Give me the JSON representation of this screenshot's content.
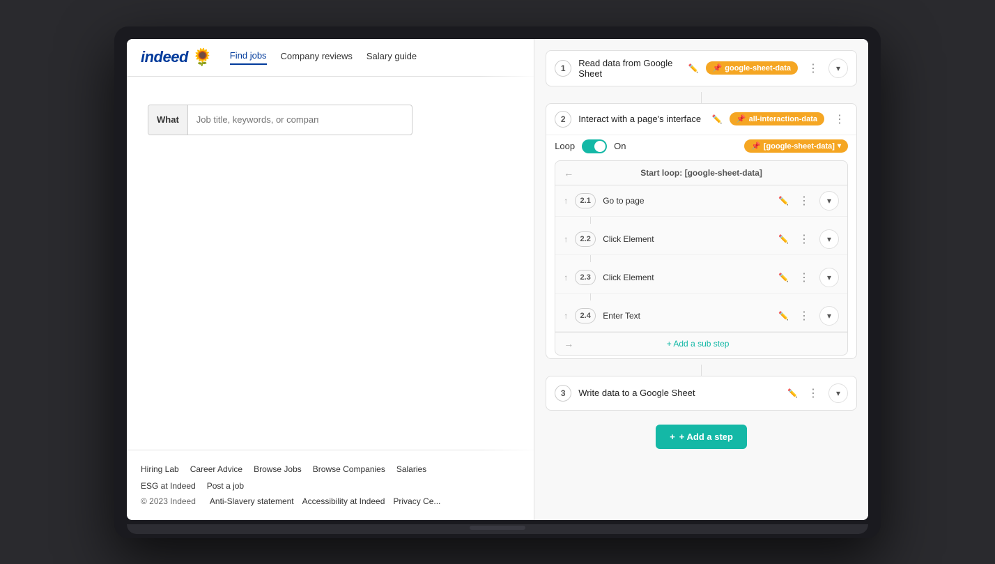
{
  "laptop": {
    "indeed": {
      "logo_text": "indeed",
      "logo_flower": "🌻",
      "nav": [
        {
          "label": "Find jobs",
          "active": true
        },
        {
          "label": "Company reviews",
          "active": false
        },
        {
          "label": "Salary guide",
          "active": false
        }
      ],
      "search_label": "What",
      "search_placeholder": "Job title, keywords, or company",
      "footer_links": [
        "Hiring Lab",
        "Career Advice",
        "Browse Jobs",
        "Browse Companies",
        "Salaries"
      ],
      "footer_bottom_links": [
        "ESG at Indeed",
        "Post a job"
      ],
      "copyright": "© 2023 Indeed",
      "legal_links": [
        "Anti-Slavery statement",
        "Accessibility at Indeed",
        "Privacy Ce..."
      ]
    },
    "workflow": {
      "steps": [
        {
          "number": "1",
          "title": "Read data from Google Sheet",
          "tag_label": "google-sheet-data",
          "tag_type": "google-sheet"
        },
        {
          "number": "2",
          "title": "Interact with a page's interface",
          "tag_label": "all-interaction-data",
          "tag_type": "interaction",
          "loop": {
            "label": "Loop",
            "toggle_on": true,
            "toggle_text": "On",
            "loop_tag": "[google-sheet-data]"
          },
          "loop_header": "Start loop: [google-sheet-data]",
          "substeps": [
            {
              "number": "2.1",
              "title": "Go to page"
            },
            {
              "number": "2.2",
              "title": "Click Element"
            },
            {
              "number": "2.3",
              "title": "Click Element"
            },
            {
              "number": "2.4",
              "title": "Enter Text"
            }
          ],
          "add_substep_label": "+ Add a sub step"
        },
        {
          "number": "3",
          "title": "Write data to a Google Sheet",
          "tag_label": null,
          "tag_type": null
        }
      ],
      "add_step_label": "+ Add a step"
    }
  }
}
